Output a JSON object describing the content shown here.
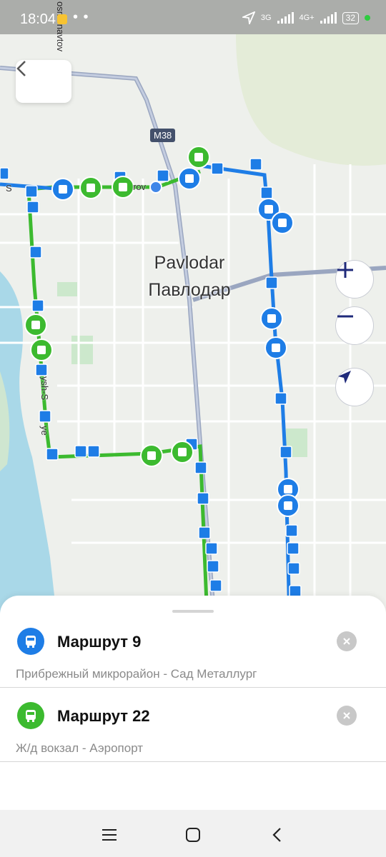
{
  "status_bar": {
    "time": "18:04",
    "dots": "• •",
    "network_1": "3G",
    "network_2": "4G+",
    "battery": "32"
  },
  "map": {
    "city_name_latin": "Pavlodar",
    "city_name_cyrillic": "Павлодар",
    "highway_label": "M38",
    "street_top": "osmonavtov",
    "street_left": "ysh-S",
    "street_left_2": "ye",
    "street_row": "S",
    "street_row_2": "rov",
    "colors": {
      "route_9": "#1e7de6",
      "route_22": "#3cba2f"
    }
  },
  "sheet": {
    "routes": [
      {
        "title": "Маршрут 9",
        "subtitle": "Прибрежный микрорайон - Сад Металлург",
        "color": "#1e7de6",
        "icon": "bus-icon"
      },
      {
        "title": "Маршрут 22",
        "subtitle": "Ж/д вокзал - Аэропорт",
        "color": "#3cba2f",
        "icon": "bus-icon"
      }
    ]
  },
  "icons": [
    "back-icon",
    "zoom-in-icon",
    "zoom-out-icon",
    "location-arrow-icon",
    "close-icon",
    "menu-icon",
    "home-icon",
    "nav-back-icon"
  ]
}
